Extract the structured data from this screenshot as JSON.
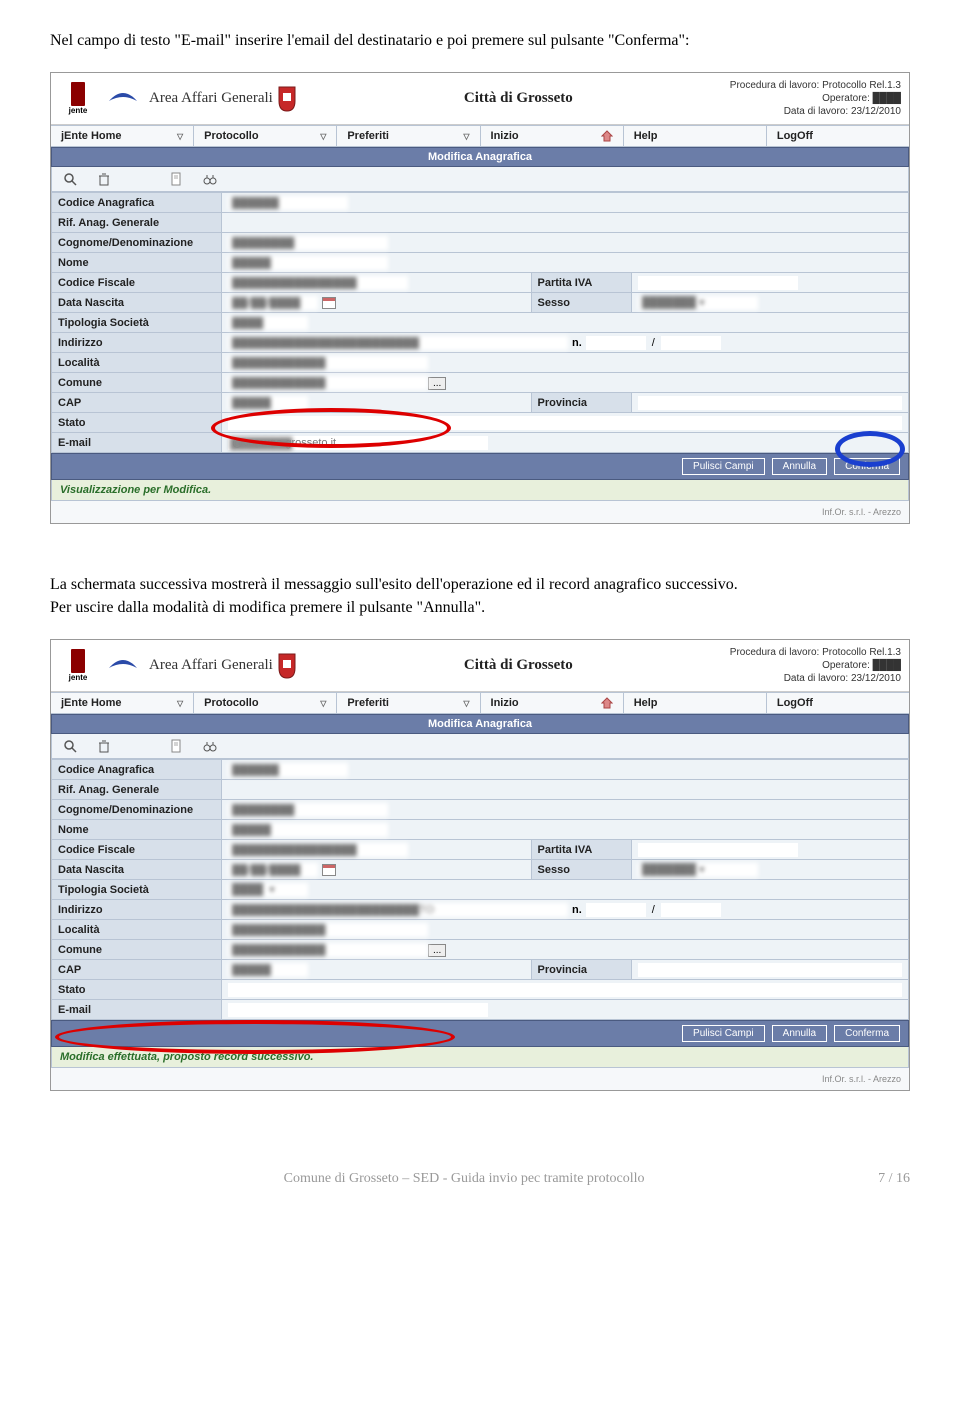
{
  "intro_text_1": "Nel campo di testo \"E-mail\" inserire l'email del destinatario e poi premere sul pulsante \"Conferma\":",
  "intro_text_2": "La schermata successiva mostrerà il messaggio sull'esito dell'operazione ed il record anagrafico successivo.",
  "intro_text_3": "Per uscire dalla modalità di modifica premere il pulsante \"Annulla\".",
  "header": {
    "area": "Area Affari Generali",
    "city": "Città di Grosseto",
    "proc": "Procedura di lavoro: Protocollo Rel.1.3",
    "oper": "Operatore:",
    "date": "Data di lavoro: 23/12/2010"
  },
  "menu": {
    "home": "jEnte Home",
    "protocollo": "Protocollo",
    "preferiti": "Preferiti",
    "inizio": "Inizio",
    "help": "Help",
    "logoff": "LogOff"
  },
  "section_title": "Modifica Anagrafica",
  "labels": {
    "codice_anagrafica": "Codice Anagrafica",
    "rif_anag": "Rif. Anag. Generale",
    "cognome": "Cognome/Denominazione",
    "nome": "Nome",
    "codice_fiscale": "Codice Fiscale",
    "partita_iva": "Partita IVA",
    "data_nascita": "Data Nascita",
    "sesso": "Sesso",
    "tipologia": "Tipologia Società",
    "indirizzo": "Indirizzo",
    "n": "n.",
    "localita": "Località",
    "comune": "Comune",
    "cap": "CAP",
    "provincia": "Provincia",
    "stato": "Stato",
    "email": "E-mail"
  },
  "buttons": {
    "pulisci": "Pulisci Campi",
    "annulla": "Annulla",
    "conferma": "Conferma"
  },
  "status1": "Visualizzazione per Modifica.",
  "status2": "Modifica effettuata, proposto record successivo.",
  "footer_credit": "Inf.Or. s.r.l. - Arezzo",
  "email_value": "@comune.grosseto.it",
  "page_footer": "Comune di Grosseto – SED - Guida invio pec tramite protocollo",
  "page_num": "7 / 16"
}
